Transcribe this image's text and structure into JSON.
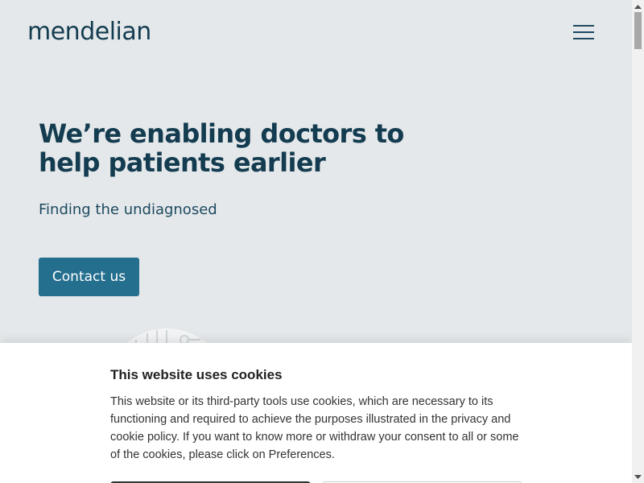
{
  "header": {
    "logo_text": "mendelian",
    "menu_icon": "hamburger-menu-icon"
  },
  "hero": {
    "headline": "We’re enabling doctors to help patients earlier",
    "subheadline": "Finding the undiagnosed",
    "cta_label": "Contact us"
  },
  "cookie_banner": {
    "title": "This website uses cookies",
    "body": "This website or its third-party tools use cookies, which are necessary to its functioning and required to achieve the purposes illustrated in the privacy and cookie policy. If you want to know more or withdraw your consent to all or some of the cookies, please click on Preferences."
  },
  "colors": {
    "brand_dark": "#143c50",
    "accent": "#246e8e",
    "background": "#e4e8ea"
  }
}
